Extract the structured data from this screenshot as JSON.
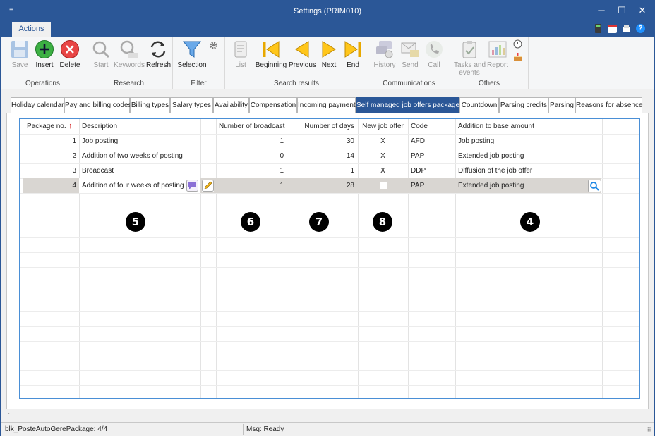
{
  "window": {
    "title": "Settings (PRIM010)",
    "minimize_glyph": "─",
    "maximize_glyph": "☐",
    "close_glyph": "✕",
    "menu_glyph": "≡"
  },
  "ribbon_tab": "Actions",
  "quick_access": {
    "help_glyph": "?"
  },
  "ribbon": {
    "groups": [
      {
        "label": "Operations",
        "buttons": [
          "Save",
          "Insert",
          "Delete"
        ]
      },
      {
        "label": "Research",
        "buttons": [
          "Start",
          "Keywords",
          "Refresh"
        ]
      },
      {
        "label": "Filter",
        "buttons": [
          "Selection"
        ]
      },
      {
        "label": "Search results",
        "buttons": [
          "List",
          "Beginning",
          "Previous",
          "Next",
          "End"
        ]
      },
      {
        "label": "Communications",
        "buttons": [
          "History",
          "Send",
          "Call"
        ]
      },
      {
        "label": "Others",
        "buttons": [
          "Tasks and events",
          "Report"
        ]
      }
    ],
    "tasks_line1": "Tasks and",
    "tasks_line2": "events"
  },
  "tabs": [
    "Holiday calendar",
    "Pay and billing codes",
    "Billing types",
    "Salary types",
    "Availability",
    "Compensation",
    "Incoming payment",
    "Self managed job offers packages",
    "Countdown",
    "Parsing credits",
    "Parsing",
    "Reasons for absence"
  ],
  "table": {
    "columns": [
      "Package no.",
      "Description",
      "Number of broadcast",
      "Number of days",
      "New job offer",
      "Code",
      "Addition to base amount"
    ],
    "sort_glyph": "↑",
    "rows": [
      {
        "no": "1",
        "description": "Job posting",
        "broadcast": "1",
        "days": "30",
        "new_offer": "X",
        "code": "AFD",
        "addition": "Job posting"
      },
      {
        "no": "2",
        "description": "Addition of two weeks of posting",
        "broadcast": "0",
        "days": "14",
        "new_offer": "X",
        "code": "PAP",
        "addition": "Extended job posting"
      },
      {
        "no": "3",
        "description": "Broadcast",
        "broadcast": "1",
        "days": "1",
        "new_offer": "X",
        "code": "DDP",
        "addition": "Diffusion of the job offer"
      },
      {
        "no": "4",
        "description": "Addition of four weeks of posting",
        "broadcast": "1",
        "days": "28",
        "new_offer": "",
        "code": "PAP",
        "addition": "Extended job posting"
      }
    ]
  },
  "callouts": [
    "5",
    "6",
    "7",
    "8",
    "4"
  ],
  "status": {
    "left": "blk_PosteAutoGerePackage: 4/4",
    "right": "Msq: Ready",
    "scroll_glyph": "ˇ",
    "grip_glyph": "⠿"
  },
  "colors": {
    "accent": "#2b5797",
    "selected_row": "#d9d6d2",
    "grid_border": "#4a8fd6"
  }
}
